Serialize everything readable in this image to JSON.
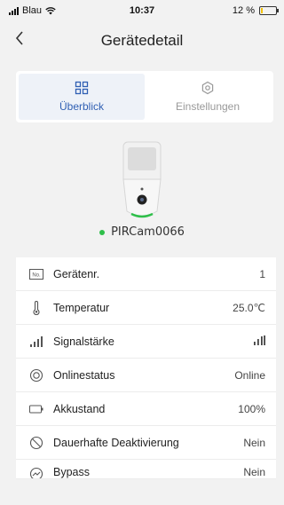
{
  "status_bar": {
    "carrier": "Blau",
    "time": "10:37",
    "battery_percent": "12 %",
    "battery_level": 0.12
  },
  "nav": {
    "back_icon": "chevron-left-icon",
    "title": "Gerätedetail"
  },
  "tabs": [
    {
      "label": "Überblick",
      "icon": "grid-icon",
      "active": true
    },
    {
      "label": "Einstellungen",
      "icon": "hexagon-settings-icon",
      "active": false
    }
  ],
  "device": {
    "name": "PIRCam0066",
    "status_color": "#2fbf4a"
  },
  "details": [
    {
      "label": "Gerätenr.",
      "value": "1",
      "icon": "number-icon"
    },
    {
      "label": "Temperatur",
      "value": "25.0℃",
      "icon": "thermometer-icon"
    },
    {
      "label": "Signalstärke",
      "value": "",
      "icon": "signal-icon"
    },
    {
      "label": "Onlinestatus",
      "value": "Online",
      "icon": "online-status-icon"
    },
    {
      "label": "Akkustand",
      "value": "100%",
      "icon": "battery-icon"
    },
    {
      "label": "Dauerhafte Deaktivierung",
      "value": "Nein",
      "icon": "disable-icon"
    },
    {
      "label": "Bypass",
      "value": "Nein",
      "icon": "bypass-icon"
    }
  ],
  "colors": {
    "accent": "#2f5fb3",
    "online": "#2fbf4a",
    "battery": "#f5c400"
  }
}
